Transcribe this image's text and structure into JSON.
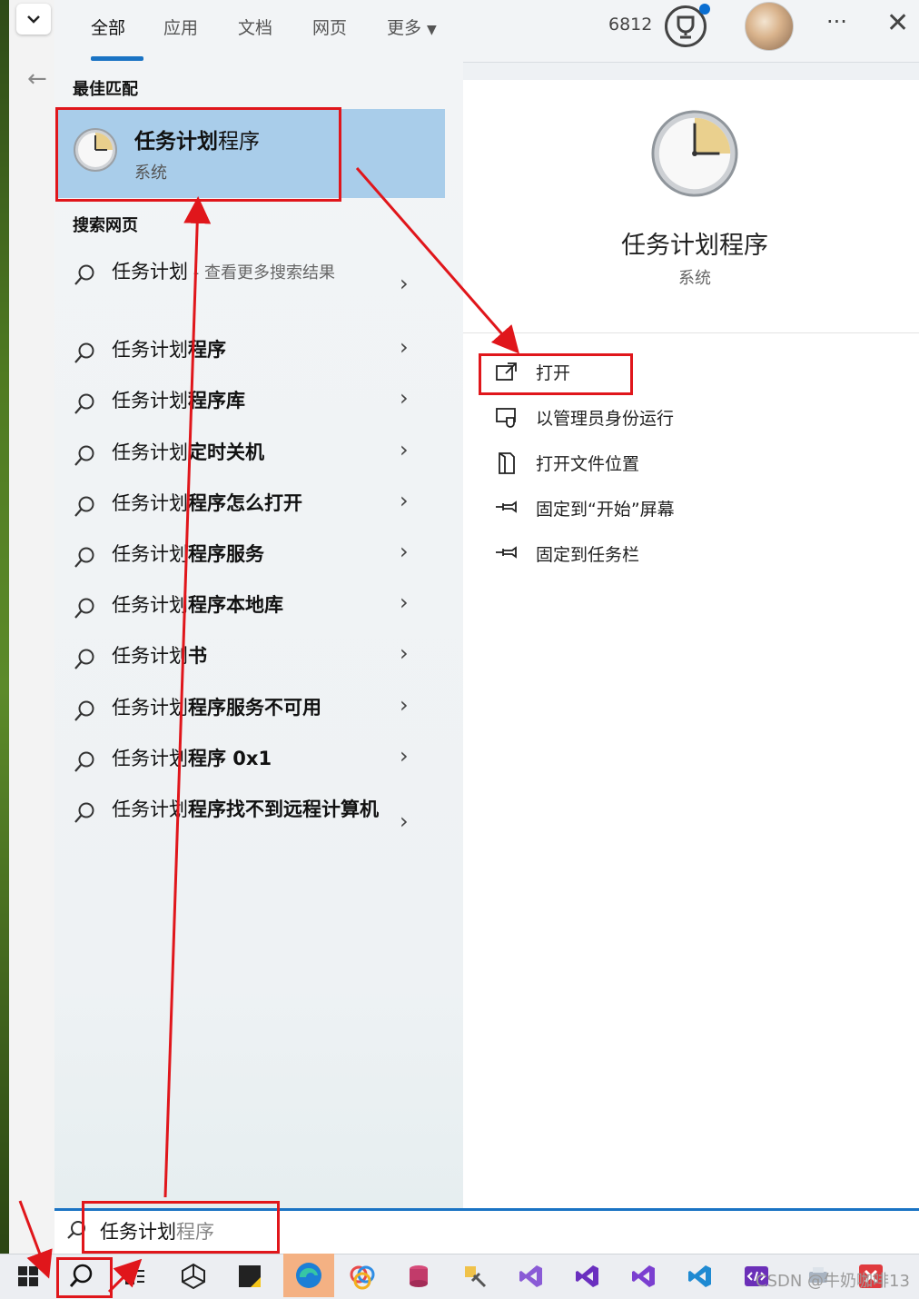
{
  "tabs": [
    {
      "label": "全部",
      "active": true
    },
    {
      "label": "应用"
    },
    {
      "label": "文档"
    },
    {
      "label": "网页"
    },
    {
      "label": "更多"
    }
  ],
  "header": {
    "points": "6812",
    "more_label": "···"
  },
  "sections": {
    "best_match": "最佳匹配",
    "search_web": "搜索网页"
  },
  "best_match": {
    "title_bold": "任务计划",
    "title_plain": "程序",
    "subtitle": "系统"
  },
  "web_results": [
    {
      "bold": "任务计划",
      "rest": " - 查看更多搜索结果",
      "style": "grey"
    },
    {
      "bold": "任务计划",
      "rest": "程序"
    },
    {
      "bold": "任务计划",
      "rest": "程序库"
    },
    {
      "bold": "任务计划",
      "rest": "定时关机"
    },
    {
      "bold": "任务计划",
      "rest": "程序怎么打开"
    },
    {
      "bold": "任务计划",
      "rest": "程序服务"
    },
    {
      "bold": "任务计划",
      "rest": "程序本地库"
    },
    {
      "bold": "任务计划",
      "rest": "书"
    },
    {
      "bold": "任务计划",
      "rest": "程序服务不可用"
    },
    {
      "bold": "任务计划",
      "rest": "程序 0x1"
    },
    {
      "bold": "任务计划",
      "rest": "程序找不到远程计算机"
    }
  ],
  "detail": {
    "title": "任务计划程序",
    "subtitle": "系统"
  },
  "actions": [
    {
      "label": "打开",
      "icon": "open-external-icon"
    },
    {
      "label": "以管理员身份运行",
      "icon": "run-as-admin-icon"
    },
    {
      "label": "打开文件位置",
      "icon": "file-location-icon"
    },
    {
      "label": "固定到“开始”屏幕",
      "icon": "pin-icon"
    },
    {
      "label": "固定到任务栏",
      "icon": "pin-icon"
    }
  ],
  "search": {
    "typed": "任务计划",
    "suggest": "程序"
  },
  "watermark": "CSDN @牛奶咖啡13",
  "colors": {
    "accent": "#1a73c4",
    "selection": "#a9cdea",
    "annotation": "#e0161b"
  }
}
